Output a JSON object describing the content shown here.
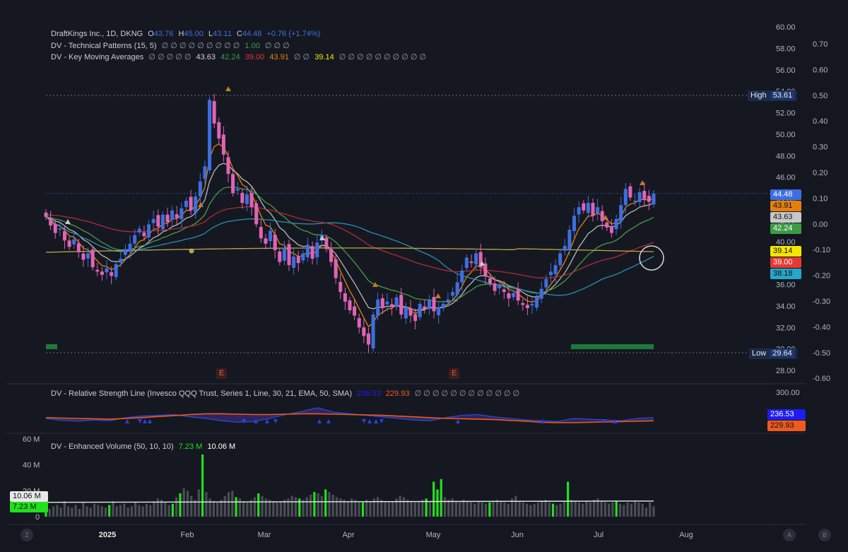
{
  "header": {
    "symbol": "DraftKings Inc., 1D, DKNG",
    "o_label": "O",
    "o_value": "43.76",
    "h_label": "H",
    "h_value": "45.00",
    "l_label": "L",
    "l_value": "43.11",
    "c_label": "C",
    "c_value": "44.48",
    "change": "+0.76 (+1.74%)"
  },
  "indicators": {
    "tech_patterns": "DV - Technical Patterns (15, 5)",
    "tech_patterns_values": "∅ ∅ ∅ ∅ ∅ ∅ ∅ ∅ ∅",
    "tech_patterns_value": "1.00",
    "tech_patterns_tail": "∅ ∅ ∅",
    "kma": "DV - Key Moving Averages",
    "kma_pre": "∅ ∅ ∅ ∅ ∅",
    "kma_values": [
      "43.63",
      "42.24",
      "39.00",
      "43.91"
    ],
    "kma_mid": "∅ ∅",
    "kma_value5": "39.14",
    "kma_tail": "∅ ∅ ∅ ∅ ∅ ∅ ∅ ∅ ∅ ∅",
    "rs_line": "DV - Relative Strength Line (Invesco QQQ Trust, Series 1, Line, 30, 21, EMA, 50, SMA)",
    "rs_values": [
      "236.53",
      "229.93"
    ],
    "rs_tail": "∅ ∅ ∅ ∅ ∅ ∅ ∅ ∅ ∅ ∅ ∅ ∅",
    "volume": "DV - Enhanced Volume (50, 10, 10)",
    "volume_values": [
      "7.23 M",
      "10.06 M"
    ]
  },
  "price_labels": {
    "high_label": "High",
    "high_value": "53.61",
    "low_label": "Low",
    "low_value": "29.64",
    "close_tag": "44.48",
    "ma_tags": [
      {
        "value": "43.91",
        "color": "#e5800f"
      },
      {
        "value": "43.63",
        "color": "#c8c8c8"
      },
      {
        "value": "42.24",
        "color": "#3c9b45"
      },
      {
        "value": "39.14",
        "color": "#f3e600"
      },
      {
        "value": "39.00",
        "color": "#e53935"
      },
      {
        "value": "38.18",
        "color": "#26a6c8"
      }
    ],
    "rs_tags": [
      {
        "value": "236.53",
        "color": "#1d1df0"
      },
      {
        "value": "229.93",
        "color": "#f05a1e"
      }
    ],
    "vol_tags": [
      "10.06 M",
      "7.23 M"
    ]
  },
  "earnings_markers": [
    "E",
    "E"
  ],
  "bottom_buttons": [
    "Z",
    "A",
    "B"
  ],
  "colors": {
    "background": "#141720",
    "up": "#3d6fe0",
    "down": "#e064b4",
    "ma_gray": "#b8b8b8",
    "ma_green": "#4b9a48",
    "ma_red": "#b02a3a",
    "ma_yellow": "#b9a64a",
    "ma_cyan": "#2c8eb0",
    "ma_orange": "#e5800f",
    "vol_green": "#22e01c",
    "vol_gray": "#4a4d55"
  },
  "chart_data": [
    {
      "type": "candlestick",
      "title": "DraftKings Inc., 1D, DKNG",
      "ylim": [
        28,
        60
      ],
      "y_ticks": [
        "60.00",
        "58.00",
        "56.00",
        "54.00",
        "52.00",
        "50.00",
        "48.00",
        "46.00",
        "44.00",
        "42.00",
        "40.00",
        "38.00",
        "36.00",
        "34.00",
        "32.00",
        "30.00",
        "28.00"
      ],
      "y2_ticks": [
        "0.70",
        "0.60",
        "0.50",
        "0.40",
        "0.30",
        "0.20",
        "0.10",
        "0.00",
        "-0.10",
        "-0.20",
        "-0.30",
        "-0.40",
        "-0.50",
        "-0.60"
      ],
      "x_ticks": [
        "2025",
        "Feb",
        "Mar",
        "Apr",
        "May",
        "Jun",
        "Jul",
        "Aug"
      ],
      "high": 53.61,
      "low": 29.64,
      "last_close": 44.48,
      "close_series": [
        42.3,
        41.5,
        40.8,
        41.2,
        40.1,
        39.5,
        40.2,
        39.0,
        38.3,
        38.9,
        37.6,
        37.2,
        36.9,
        37.5,
        36.8,
        37.9,
        38.4,
        39.3,
        39.8,
        40.6,
        41.2,
        40.5,
        41.6,
        42.1,
        41.4,
        42.5,
        41.8,
        42.9,
        42.2,
        43.1,
        43.8,
        42.9,
        44.2,
        45.6,
        47.0,
        53.2,
        51.0,
        49.6,
        48.1,
        46.3,
        44.5,
        44.9,
        43.6,
        44.4,
        43.2,
        41.6,
        40.3,
        39.8,
        41.0,
        39.2,
        38.1,
        39.4,
        37.8,
        38.6,
        38.0,
        38.9,
        39.7,
        38.4,
        39.9,
        40.6,
        39.3,
        38.1,
        36.6,
        35.3,
        34.4,
        33.6,
        33.1,
        32.0,
        31.2,
        30.4,
        33.2,
        34.6,
        33.8,
        34.4,
        33.9,
        34.8,
        33.2,
        33.9,
        33.1,
        32.6,
        34.2,
        33.7,
        34.6,
        33.5,
        33.9,
        34.2,
        34.6,
        35.3,
        36.2,
        37.3,
        38.5,
        38.0,
        38.9,
        37.6,
        36.8,
        36.1,
        35.4,
        35.9,
        35.3,
        34.7,
        35.2,
        34.5,
        34.1,
        33.8,
        34.2,
        34.8,
        35.6,
        36.5,
        37.2,
        37.8,
        38.9,
        39.6,
        41.1,
        42.4,
        43.2,
        42.9,
        43.6,
        42.4,
        43.2,
        41.9,
        41.3,
        40.8,
        42.1,
        43.4,
        44.9,
        44.1,
        43.8,
        44.6,
        43.9,
        43.7,
        44.48
      ],
      "moving_averages": [
        {
          "name": "43.63",
          "color": "#b8b8b8"
        },
        {
          "name": "42.24",
          "color": "#4b9a48"
        },
        {
          "name": "39.00",
          "color": "#b02a3a"
        },
        {
          "name": "39.14",
          "color": "#b9a64a"
        },
        {
          "name": "38.18",
          "color": "#2c8eb0"
        },
        {
          "name": "43.91",
          "color": "#e5800f"
        }
      ]
    },
    {
      "type": "line",
      "title": "DV - Relative Strength Line (Invesco QQQ Trust, Series 1, Line, 30, 21, EMA, 50, SMA)",
      "y_ticks": [
        "300.00"
      ],
      "series": [
        {
          "name": "236.53",
          "values": [
            236,
            231,
            229,
            232,
            230,
            238,
            242,
            244,
            246,
            240,
            236,
            230,
            226,
            228,
            236,
            246,
            254,
            263,
            252,
            248,
            244,
            240,
            236,
            232,
            230,
            238,
            244,
            246,
            240,
            236,
            232,
            230,
            228,
            236,
            234,
            232,
            230,
            236,
            238
          ]
        },
        {
          "name": "229.93",
          "values": [
            238,
            237,
            236,
            235,
            234,
            236,
            238,
            241,
            243,
            246,
            248,
            248,
            247,
            246,
            246,
            247,
            248,
            248,
            247,
            246,
            245,
            244,
            242,
            240,
            238,
            236,
            235,
            234,
            233,
            231,
            229,
            226,
            225,
            225,
            226,
            227,
            228,
            229,
            230
          ]
        }
      ]
    },
    {
      "type": "bar",
      "title": "DV - Enhanced Volume (50, 10, 10)",
      "ylim": [
        0,
        60
      ],
      "y_ticks": [
        "60 M",
        "40 M",
        "20 M",
        "0"
      ],
      "values": [
        7,
        6,
        8,
        9,
        7,
        12,
        8,
        7,
        9,
        6,
        11,
        8,
        7,
        10,
        9,
        8,
        7,
        9,
        12,
        8,
        9,
        10,
        7,
        8,
        11,
        9,
        8,
        10,
        9,
        12,
        14,
        13,
        11,
        9,
        10,
        15,
        18,
        22,
        20,
        16,
        13,
        21,
        48,
        19,
        14,
        12,
        11,
        13,
        16,
        19,
        20,
        15,
        14,
        12,
        11,
        13,
        15,
        18,
        16,
        14,
        13,
        12,
        11,
        12,
        13,
        14,
        16,
        15,
        14,
        13,
        15,
        17,
        19,
        18,
        16,
        21,
        19,
        17,
        15,
        14,
        13,
        12,
        14,
        13,
        12,
        11,
        13,
        12,
        14,
        15,
        13,
        12,
        11,
        12,
        14,
        16,
        15,
        13,
        12,
        11,
        12,
        13,
        14,
        12,
        27,
        21,
        29,
        15,
        13,
        14,
        12,
        11,
        13,
        12,
        11,
        10,
        12,
        11,
        10,
        11,
        12,
        13,
        12,
        11,
        10,
        14,
        16,
        12,
        11,
        10,
        9,
        10,
        11,
        12,
        13,
        11,
        10,
        9,
        10,
        12,
        27,
        13,
        12,
        11,
        10,
        12,
        11,
        13,
        14,
        12,
        11,
        10,
        11,
        12,
        10,
        9,
        11,
        10,
        12,
        11,
        10,
        7,
        11,
        8
      ],
      "avg_line_value": 10.06,
      "last_value": 7.23
    }
  ]
}
